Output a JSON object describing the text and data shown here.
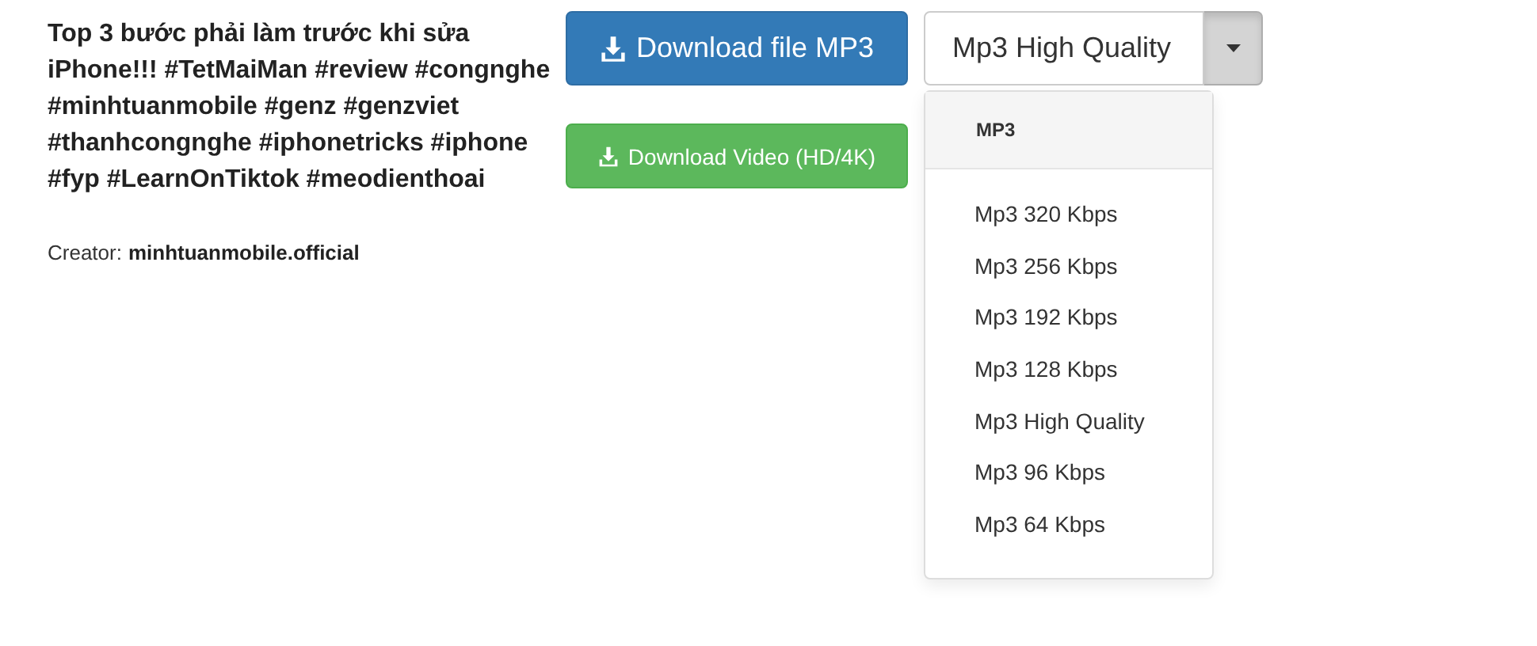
{
  "video": {
    "title": "Top 3 bước phải làm trước khi sửa iPhone!!! #TetMaiMan #review #congnghe #minhtuanmobile #genz #genzviet #thanhcongnghe #iphonetricks #iphone #fyp #LearnOnTiktok #meodienthoai",
    "creator_label": "Creator:",
    "creator": "minhtuanmobile.official"
  },
  "buttons": [
    {
      "kind": "primary",
      "label": "Download file MP3"
    },
    {
      "kind": "success",
      "label": "Download Video (HD/4K)"
    }
  ],
  "quality_select": {
    "value": "Mp3 High Quality",
    "expanded": true,
    "menu": {
      "header": "MP3",
      "options": [
        "Mp3 320 Kbps",
        "Mp3 256 Kbps",
        "Mp3 192 Kbps",
        "Mp3 128 Kbps",
        "Mp3 High Quality",
        "Mp3 96 Kbps",
        "Mp3 64 Kbps"
      ]
    }
  }
}
